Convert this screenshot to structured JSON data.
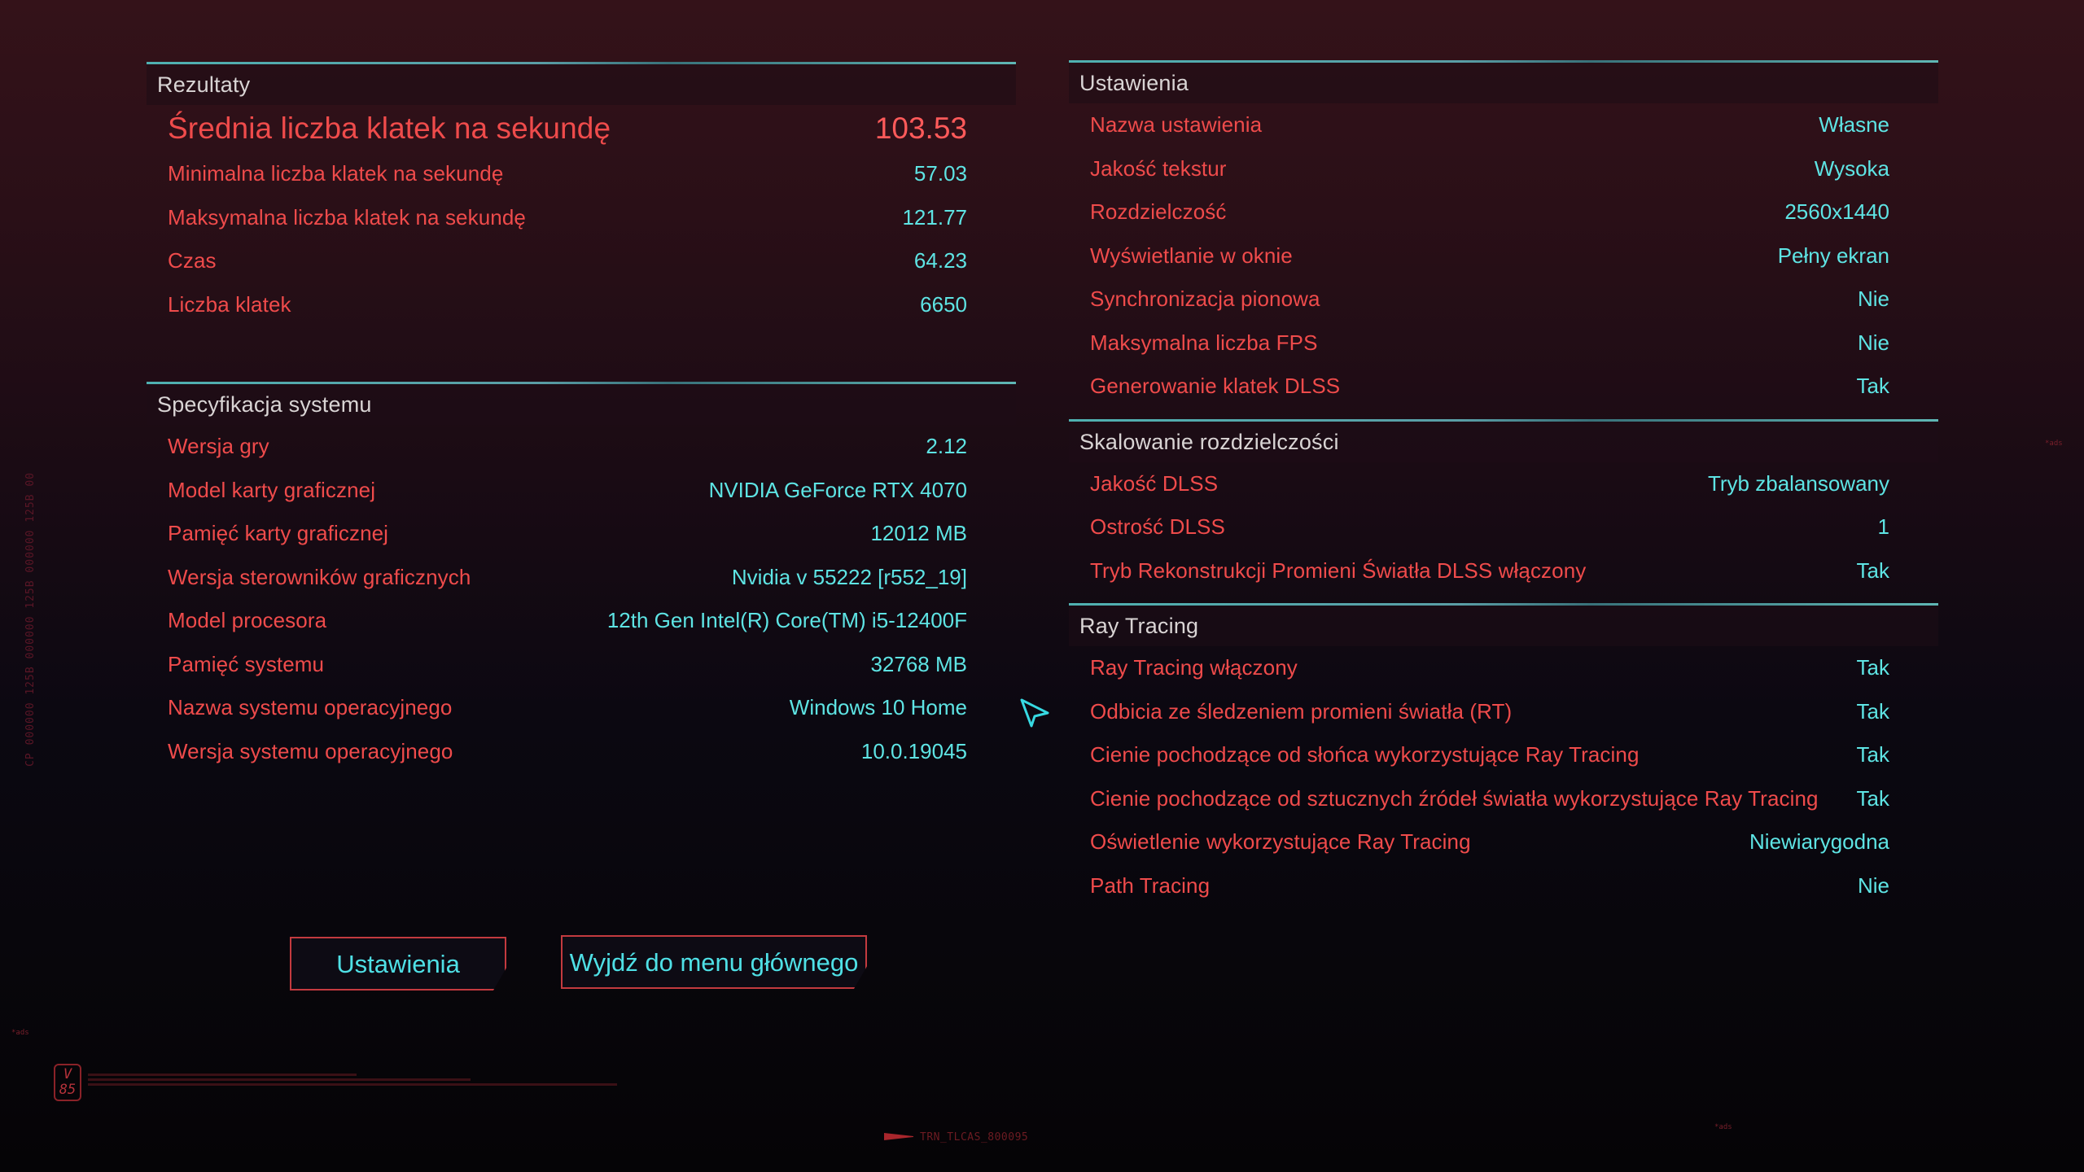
{
  "results": {
    "title": "Rezultaty",
    "rows": [
      {
        "label": "Średnia liczba klatek na sekundę",
        "value": "103.53"
      },
      {
        "label": "Minimalna liczba klatek na sekundę",
        "value": "57.03"
      },
      {
        "label": "Maksymalna liczba klatek na sekundę",
        "value": "121.77"
      },
      {
        "label": "Czas",
        "value": "64.23"
      },
      {
        "label": "Liczba klatek",
        "value": "6650"
      }
    ]
  },
  "system": {
    "title": "Specyfikacja systemu",
    "rows": [
      {
        "label": "Wersja gry",
        "value": "2.12"
      },
      {
        "label": "Model karty graficznej",
        "value": "NVIDIA GeForce RTX 4070"
      },
      {
        "label": "Pamięć karty graficznej",
        "value": "12012 MB"
      },
      {
        "label": "Wersja sterowników graficznych",
        "value": "Nvidia v 55222 [r552_19]"
      },
      {
        "label": "Model procesora",
        "value": "12th Gen Intel(R) Core(TM) i5-12400F"
      },
      {
        "label": "Pamięć systemu",
        "value": "32768 MB"
      },
      {
        "label": "Nazwa systemu operacyjnego",
        "value": "Windows 10 Home"
      },
      {
        "label": "Wersja systemu operacyjnego",
        "value": "10.0.19045"
      }
    ]
  },
  "settings": {
    "title": "Ustawienia",
    "rows": [
      {
        "label": "Nazwa ustawienia",
        "value": "Własne"
      },
      {
        "label": "Jakość tekstur",
        "value": "Wysoka"
      },
      {
        "label": "Rozdzielczość",
        "value": "2560x1440"
      },
      {
        "label": "Wyświetlanie w oknie",
        "value": "Pełny ekran"
      },
      {
        "label": "Synchronizacja pionowa",
        "value": "Nie"
      },
      {
        "label": "Maksymalna liczba FPS",
        "value": "Nie"
      },
      {
        "label": "Generowanie klatek DLSS",
        "value": "Tak"
      }
    ]
  },
  "scaling": {
    "title": "Skalowanie rozdzielczości",
    "rows": [
      {
        "label": "Jakość DLSS",
        "value": "Tryb zbalansowany"
      },
      {
        "label": "Ostrość DLSS",
        "value": "1"
      },
      {
        "label": "Tryb Rekonstrukcji Promieni Światła DLSS włączony",
        "value": "Tak"
      }
    ]
  },
  "raytracing": {
    "title": "Ray Tracing",
    "rows": [
      {
        "label": "Ray Tracing włączony",
        "value": "Tak"
      },
      {
        "label": "Odbicia ze śledzeniem promieni światła (RT)",
        "value": "Tak"
      },
      {
        "label": "Cienie pochodzące od słońca wykorzystujące Ray Tracing",
        "value": "Tak"
      },
      {
        "label": "Cienie pochodzące od sztucznych źródeł światła wykorzystujące Ray Tracing",
        "value": "Tak"
      },
      {
        "label": "Oświetlenie wykorzystujące Ray Tracing",
        "value": "Niewiarygodna"
      },
      {
        "label": "Path Tracing",
        "value": "Nie"
      }
    ]
  },
  "buttons": {
    "settings": "Ustawienia",
    "exit": "Wyjdź do menu głównego"
  },
  "decor": {
    "vertical_code": "CP 000000 125B 000000 125B 000000 125B 00",
    "badge": "V 85",
    "footer_code": "TRN_TLCAS_800095",
    "tag": "*ads"
  }
}
